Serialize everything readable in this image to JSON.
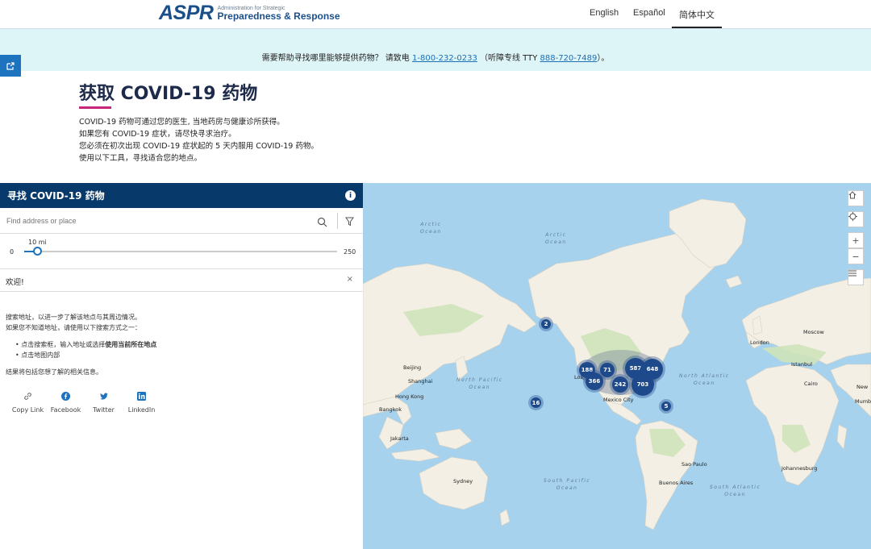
{
  "header": {
    "logo_mark": "ASPR",
    "logo_line1": "Administration for Strategic",
    "logo_line2": "Preparedness & Response",
    "languages": [
      "English",
      "Español",
      "简体中文"
    ],
    "active_language": "简体中文"
  },
  "help": {
    "prefix": "需要帮助寻找哪里能够提供药物？ 请致电",
    "phone": "1-800-232-0233",
    "middle": "（听障专线 TTY",
    "tty": "888-720-7489",
    "suffix": "）。"
  },
  "intro": {
    "title": "获取 COVID-19 药物",
    "lines": [
      "COVID-19 药物可通过您的医生, 当地药房与健康诊所获得。",
      "如果您有 COVID-19 症状，请尽快寻求治疗。",
      "您必须在初次出现 COVID-19 症状起的 5 天内服用 COVID-19 药物。",
      "使用以下工具，寻找适合您的地点。"
    ]
  },
  "panel": {
    "title": "寻找 COVID-19 药物",
    "search_placeholder": "Find address or place",
    "slider": {
      "value_label": "10 mi",
      "min": "0",
      "max": "250",
      "value_fraction": 0.04
    },
    "welcome_title": "欢迎!",
    "welcome_close": "×",
    "welcome_p1": "搜索地址，以进一步了解该地点与其周边情况。",
    "welcome_p2": "如果您不知道地址，请使用以下搜索方式之一：",
    "bullet1_pre": "点击搜索框，输入地址或选择",
    "bullet1_bold": "使用当前所在地点",
    "bullet2": "点击地图内部",
    "welcome_p3": "结果将包括您想了解的相关信息。",
    "share": [
      "Copy Link",
      "Facebook",
      "Twitter",
      "LinkedIn"
    ]
  },
  "map": {
    "oceans": {
      "arctic1": "Arctic\nOcean",
      "arctic2": "Arctic\nOcean",
      "npacific": "North Pacific\nOcean",
      "natlantic": "North Atlantic\nOcean",
      "spacific": "South Pacific\nOcean",
      "satlantic": "South Atlantic\nOcean"
    },
    "cities": [
      "Beijing",
      "Shanghai",
      "Hong Kong",
      "Bangkok",
      "Jakarta",
      "Sydney",
      "Mexico City",
      "Sao Paulo",
      "Buenos Aires",
      "Johannesburg",
      "Cairo",
      "Istanbul",
      "Moscow",
      "London",
      "New",
      "Mumb",
      "Los"
    ],
    "clusters": [
      "2",
      "188",
      "71",
      "587",
      "648",
      "366",
      "242",
      "703",
      "5",
      "16"
    ]
  }
}
